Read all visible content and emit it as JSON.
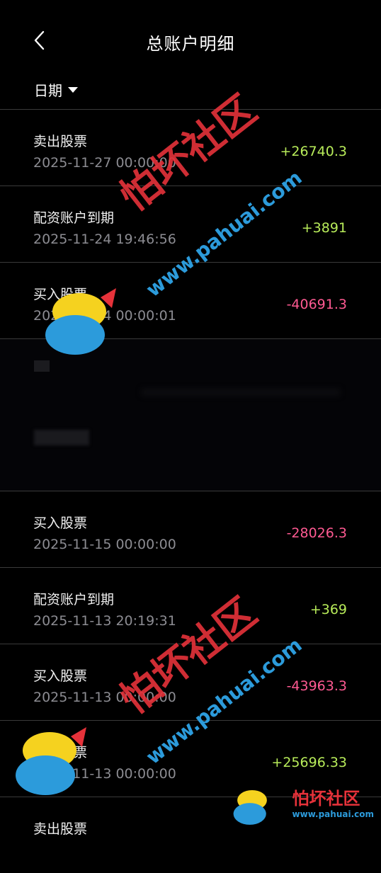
{
  "header": {
    "title": "总账户明细",
    "date_filter_label": "日期"
  },
  "records": [
    {
      "label": "卖出股票",
      "time": "2025-11-27 00:00:00",
      "amount": "+26740.3",
      "type": "pos"
    },
    {
      "label": "配资账户到期",
      "time": "2025-11-24 19:46:56",
      "amount": "+3891",
      "type": "pos"
    },
    {
      "label": "买入股票",
      "time": "2025-11-24 00:00:01",
      "amount": "-40691.3",
      "type": "neg"
    },
    {
      "label": "",
      "time": "",
      "amount": "",
      "type": "hidden"
    },
    {
      "label": "买入股票",
      "time": "2025-11-15 00:00:00",
      "amount": "-28026.3",
      "type": "neg"
    },
    {
      "label": "配资账户到期",
      "time": "2025-11-13 20:19:31",
      "amount": "+369",
      "type": "pos"
    },
    {
      "label": "买入股票",
      "time": "2025-11-13 00:00:00",
      "amount": "-43963.3",
      "type": "neg"
    },
    {
      "label": "卖出股票",
      "time": "2025-11-13 00:00:00",
      "amount": "+25696.33",
      "type": "pos"
    },
    {
      "label": "卖出股票",
      "time": "",
      "amount": "",
      "type": "pos"
    }
  ],
  "watermark": {
    "brand": "怕坏社区",
    "url": "www.pahuai.com"
  },
  "colors": {
    "positive": "#b8ec5a",
    "negative": "#ff5a92",
    "background": "#000000"
  }
}
